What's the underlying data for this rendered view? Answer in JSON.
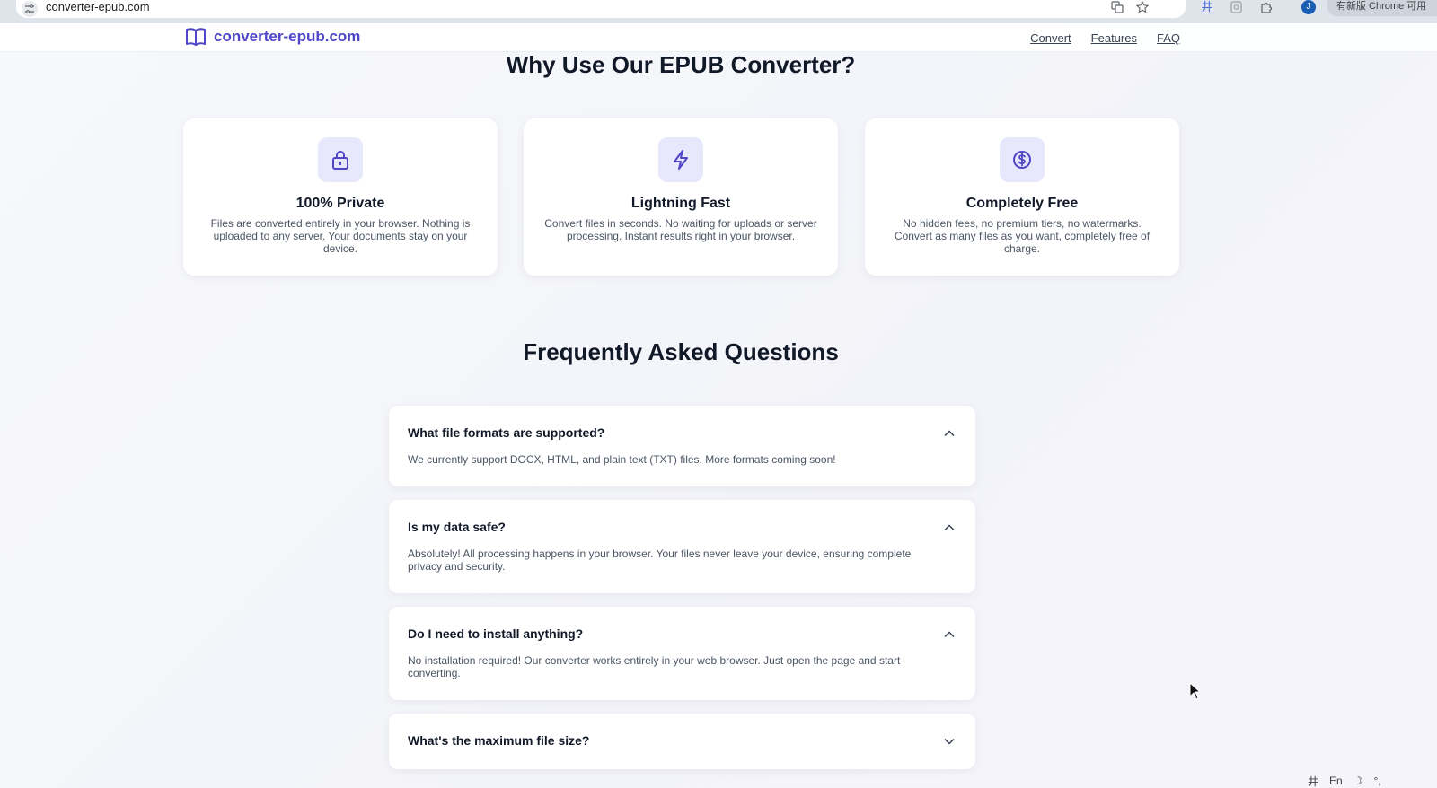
{
  "browser": {
    "url": "converter-epub.com",
    "profile_initial": "J",
    "update_label": "有新版 Chrome 可用",
    "extension_glyph": "井"
  },
  "header": {
    "logo_text": "converter-epub.com",
    "nav": [
      {
        "label": "Convert"
      },
      {
        "label": "Features"
      },
      {
        "label": "FAQ"
      }
    ]
  },
  "features": {
    "title": "Why Use Our EPUB Converter?",
    "items": [
      {
        "icon": "lock-icon",
        "title": "100% Private",
        "desc": "Files are converted entirely in your browser. Nothing is uploaded to any server. Your documents stay on your device."
      },
      {
        "icon": "lightning-icon",
        "title": "Lightning Fast",
        "desc": "Convert files in seconds. No waiting for uploads or server processing. Instant results right in your browser."
      },
      {
        "icon": "dollar-icon",
        "title": "Completely Free",
        "desc": "No hidden fees, no premium tiers, no watermarks. Convert as many files as you want, completely free of charge."
      }
    ]
  },
  "faq": {
    "title": "Frequently Asked Questions",
    "items": [
      {
        "question": "What file formats are supported?",
        "answer": "We currently support DOCX, HTML, and plain text (TXT) files. More formats coming soon!",
        "expanded": true
      },
      {
        "question": "Is my data safe?",
        "answer": "Absolutely! All processing happens in your browser. Your files never leave your device, ensuring complete privacy and security.",
        "expanded": true
      },
      {
        "question": "Do I need to install anything?",
        "answer": "No installation required! Our converter works entirely in your web browser. Just open the page and start converting.",
        "expanded": true
      },
      {
        "question": "What's the maximum file size?",
        "answer": "",
        "expanded": false
      }
    ]
  },
  "tray": {
    "input_glyph": "井",
    "lang": "En",
    "moon_glyph": "☽",
    "settings_glyph": "°,"
  },
  "colors": {
    "brand": "#4f46c8",
    "icon_bg": "#e7e8fb"
  }
}
